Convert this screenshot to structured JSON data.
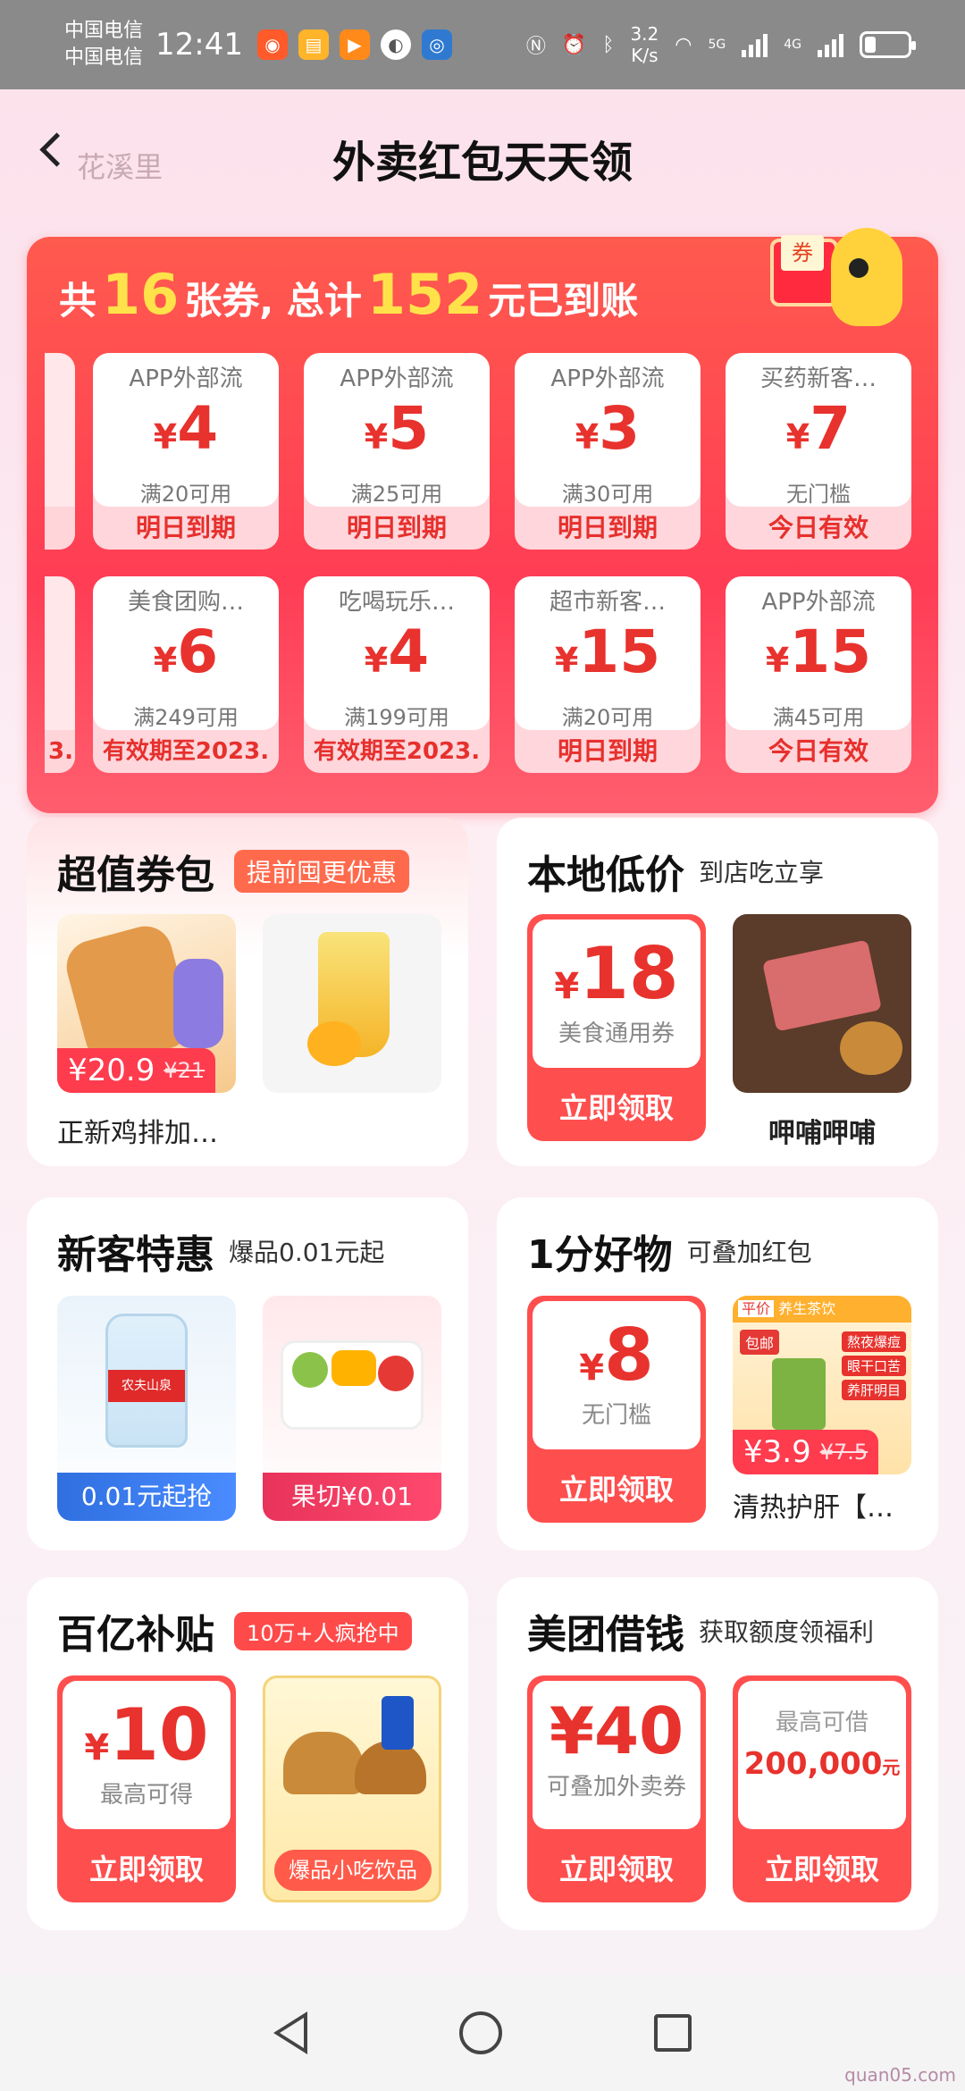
{
  "status_bar": {
    "carrier1": "中国电信",
    "carrier2": "中国电信",
    "time": "12:41",
    "speed_value": "3.2",
    "speed_unit": "K/s",
    "net1": "5G",
    "net2": "4G"
  },
  "header": {
    "location": "花溪里",
    "title": "外卖红包天天领"
  },
  "coupons": {
    "header_prefix": "共",
    "count": "16",
    "header_mid": "张券, 总计",
    "total": "152",
    "header_suffix": "元已到账",
    "mascot_label": "券",
    "row1_edge": "",
    "row2_edge": "3.",
    "items": [
      {
        "name": "APP外部流",
        "currency": "¥",
        "amount": "4",
        "condition": "满20可用",
        "expire": "明日到期"
      },
      {
        "name": "APP外部流",
        "currency": "¥",
        "amount": "5",
        "condition": "满25可用",
        "expire": "明日到期"
      },
      {
        "name": "APP外部流",
        "currency": "¥",
        "amount": "3",
        "condition": "满30可用",
        "expire": "明日到期"
      },
      {
        "name": "买药新客…",
        "currency": "¥",
        "amount": "7",
        "condition": "无门槛",
        "expire": "今日有效"
      },
      {
        "name": "美食团购…",
        "currency": "¥",
        "amount": "6",
        "condition": "满249可用",
        "expire": "有效期至2023."
      },
      {
        "name": "吃喝玩乐…",
        "currency": "¥",
        "amount": "4",
        "condition": "满199可用",
        "expire": "有效期至2023."
      },
      {
        "name": "超市新客…",
        "currency": "¥",
        "amount": "15",
        "condition": "满20可用",
        "expire": "明日到期"
      },
      {
        "name": "APP外部流",
        "currency": "¥",
        "amount": "15",
        "condition": "满45可用",
        "expire": "今日有效"
      }
    ]
  },
  "cards": {
    "value_pack": {
      "title": "超值券包",
      "tag": "提前囤更优惠",
      "product_price": "¥20.9",
      "product_old_price": "¥21",
      "product_name": "正新鸡排加…"
    },
    "local": {
      "title": "本地低价",
      "subtitle": "到店吃立享",
      "currency": "¥",
      "amount": "18",
      "caption": "美食通用券",
      "button": "立即领取",
      "shop_name": "呷哺呷哺"
    },
    "new_user": {
      "title": "新客特惠",
      "subtitle": "爆品0.01元起",
      "label1": "0.01元起抢",
      "label2": "果切¥0.01",
      "water_brand": "农夫山泉"
    },
    "penny": {
      "title": "1分好物",
      "subtitle": "可叠加红包",
      "currency": "¥",
      "amount": "8",
      "caption": "无门槛",
      "button": "立即领取",
      "product_price": "¥3.9",
      "product_old_price": "¥7.5",
      "product_name": "清热护肝【…",
      "badge": "包邮",
      "banner": "养生茶饮",
      "banner_tag": "平价",
      "points": [
        "熬夜爆痘",
        "眼干口苦",
        "养肝明目"
      ]
    },
    "subsidy": {
      "title": "百亿补贴",
      "tag": "10万+人疯抢中",
      "currency": "¥",
      "amount": "10",
      "caption": "最高可得",
      "button": "立即领取",
      "food_label": "爆品小吃饮品"
    },
    "loan": {
      "title": "美团借钱",
      "subtitle": "获取额度领福利",
      "amount1": "¥40",
      "caption1": "可叠加外卖券",
      "button1": "立即领取",
      "label2": "最高可借",
      "amount2": "200,000",
      "unit2": "元",
      "button2": "立即领取"
    }
  },
  "watermark": "quan05.com",
  "colors": {
    "accent_red": "#e8322d",
    "panel_red": "#ff3d55",
    "highlight_yellow": "#ffe24a",
    "blue": "#2f6fe0"
  }
}
